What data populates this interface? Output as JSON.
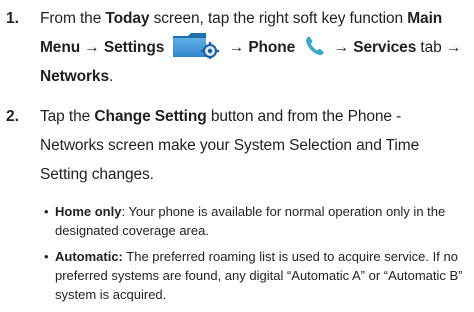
{
  "steps": [
    {
      "number": "1.",
      "t1": "From the ",
      "b1": "Today",
      "t2": " screen, tap the right soft key function ",
      "b2": "Main Menu",
      "arrow1": " → ",
      "b3": "Settings",
      "arrow2": " → ",
      "b4": "Phone",
      "arrow3": " → ",
      "b5": "Services",
      "t3": " tab → ",
      "b6": "Networks",
      "t4": "."
    },
    {
      "number": "2.",
      "t1": "Tap the ",
      "b1": "Change Setting",
      "t2": " button and from the Phone - Networks screen make your System Selection and Time Setting changes."
    }
  ],
  "bullets": [
    {
      "dot": "•",
      "label": "Home only",
      "text": ": Your phone is available for normal operation only in the designated coverage area."
    },
    {
      "dot": "•",
      "label": "Automatic:",
      "text": " The preferred roaming list is used to acquire service. If no preferred systems are found, any digital “Automatic A” or “Automatic B” system is acquired."
    }
  ],
  "icons": {
    "settings": "folder-gear-icon",
    "phone": "phone-handset-icon"
  },
  "colors": {
    "text": "#231f20",
    "folder_blue": "#2f86c8",
    "gear_blue": "#1b5f9e",
    "phone_teal": "#3aa7c9"
  }
}
